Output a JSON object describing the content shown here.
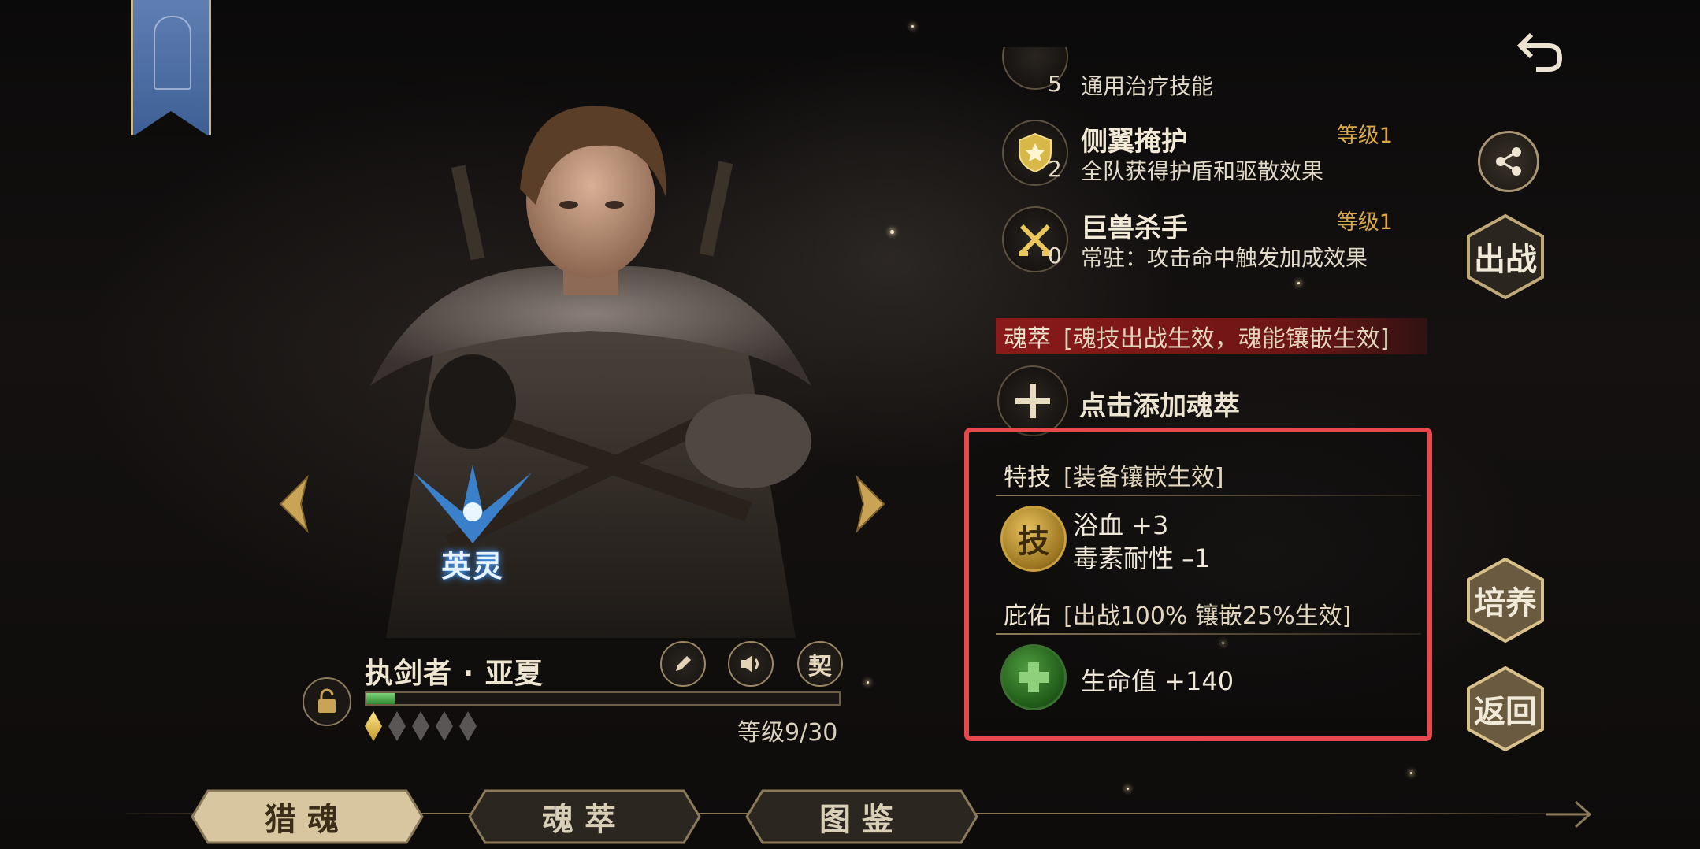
{
  "colors": {
    "accent_gold": "#d8a74a",
    "highlight_red": "#e8474c",
    "section_red": "#8b1a1a",
    "panel_text": "#efe4cd"
  },
  "character": {
    "name": "执剑者 · 亚夏",
    "class_badge": "英灵",
    "level_text": "等级9/30",
    "xp_progress": 0.06,
    "stars_total": 5,
    "stars_filled": 1
  },
  "character_actions": {
    "edit_icon": "pencil-icon",
    "voice_icon": "speaker-icon",
    "contract_label": "契"
  },
  "skills": [
    {
      "name": "",
      "num": "5",
      "desc": "通用治疗技能",
      "level": ""
    },
    {
      "name": "侧翼掩护",
      "num": "2",
      "desc": "全队获得护盾和驱散效果",
      "level": "等级1",
      "icon": "shield-icon"
    },
    {
      "name": "巨兽杀手",
      "num": "0",
      "desc": "常驻：攻击命中触发加成效果",
      "level": "等级1",
      "icon": "crossed-swords-icon"
    }
  ],
  "soul_essence": {
    "title": "魂萃",
    "note": "[魂技出战生效，魂能镶嵌生效]",
    "add_label": "点击添加魂萃"
  },
  "special_skill": {
    "title": "特技",
    "note": "[装备镶嵌生效]",
    "gem_char": "技",
    "stats": [
      "浴血  +3",
      "毒素耐性  –1"
    ]
  },
  "blessing": {
    "title": "庇佑",
    "note": "[出战100% 镶嵌25%生效]",
    "stat": "生命值 +140"
  },
  "side_buttons": {
    "deploy": "出战",
    "train": "培养",
    "return": "返回"
  },
  "tabs": [
    {
      "label": "猎魂",
      "active": true
    },
    {
      "label": "魂萃",
      "active": false
    },
    {
      "label": "图鉴",
      "active": false
    }
  ]
}
